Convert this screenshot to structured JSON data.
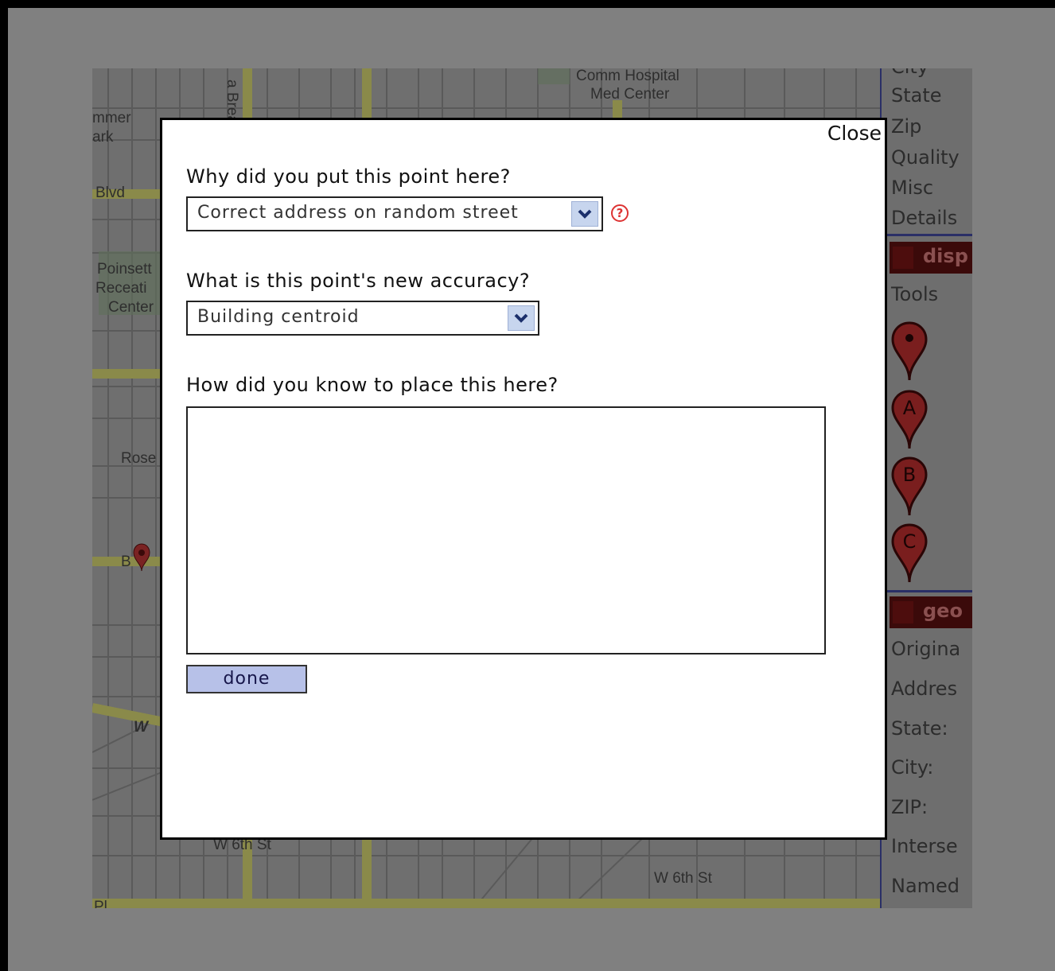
{
  "map": {
    "labels": {
      "comm_hospital": "Comm Hospital",
      "med_center": "Med Center",
      "street_top": "a Brea",
      "park1": "mmer",
      "park2": "ark",
      "blvd": "Blvd",
      "poinsett1": "Poinsett",
      "poinsett2": "Receati",
      "poinsett3": "Center",
      "rose": "Rose",
      "blvd2": "B",
      "w_label": "W",
      "w6th_left": "W 6th St",
      "w6th_right": "W 6th St",
      "bottom_left": "Pl"
    }
  },
  "side_panel": {
    "rows_top": [
      "City",
      "State",
      "Zip",
      "Quality",
      "Misc",
      "Details"
    ],
    "header_display": "disp",
    "tools_label": "Tools",
    "pins": [
      "",
      "A",
      "B",
      "C"
    ],
    "header_geo": "geo",
    "rows_bottom": [
      "Origina",
      "Addres",
      "State:",
      "City:",
      "ZIP:",
      "Interse",
      "Named"
    ]
  },
  "dialog": {
    "close_label": "Close",
    "q1": "Why did you put this point here?",
    "q1_value": "Correct address on random street",
    "help_glyph": "?",
    "q2": "What is this point's new accuracy?",
    "q2_value": "Building centroid",
    "q3": "How did you know to place this here?",
    "q3_value": "",
    "done_label": "done"
  },
  "colors": {
    "overlay": "#808080",
    "done_button": "#b7c1e8",
    "marker": "#8c1f1f",
    "panel_border": "#2a2f66"
  }
}
